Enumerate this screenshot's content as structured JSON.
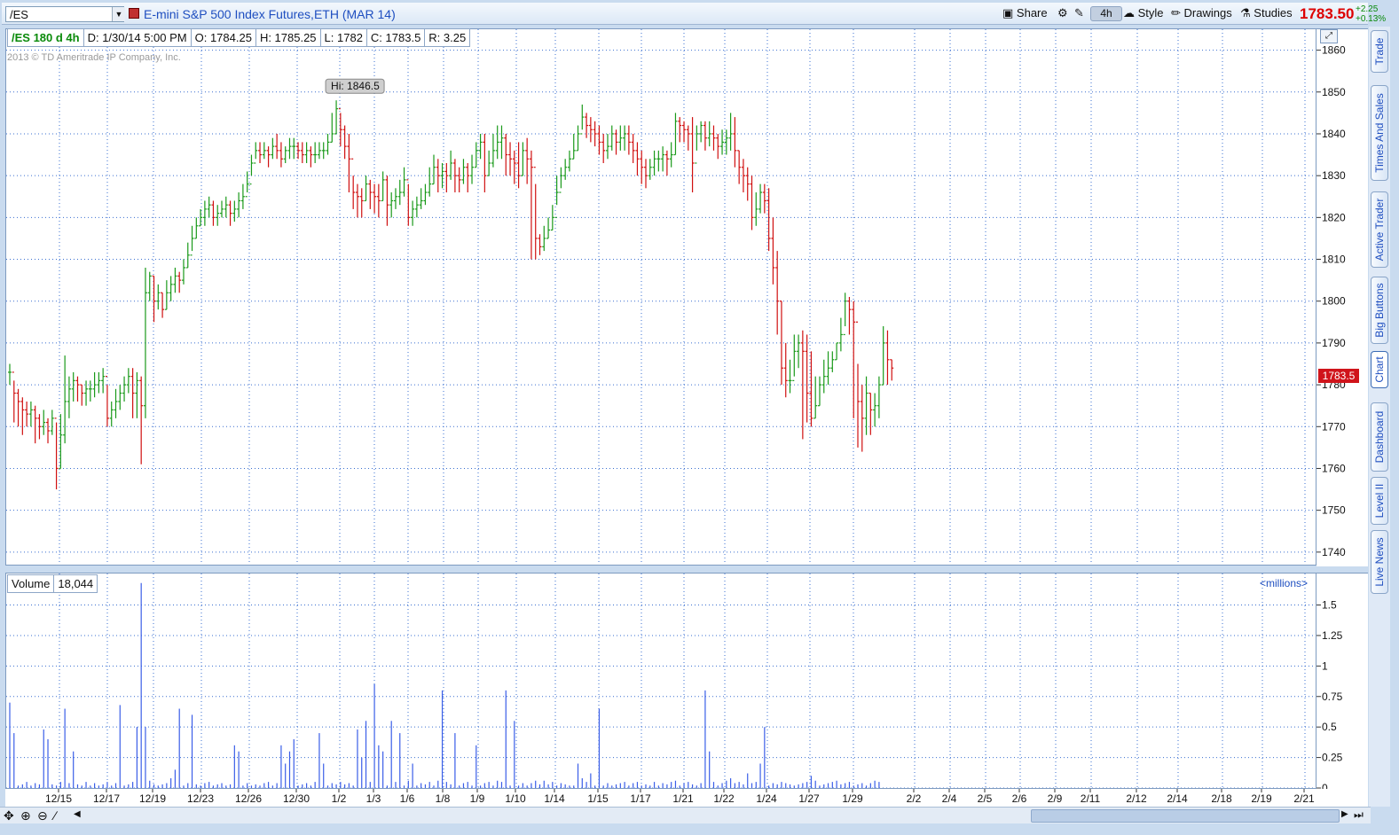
{
  "header": {
    "symbol": "/ES",
    "description": "E-mini S&P 500 Index Futures,ETH (MAR 14)",
    "share_label": "Share",
    "aggregation_label": "4h",
    "style_label": "Style",
    "drawings_label": "Drawings",
    "studies_label": "Studies",
    "last_price": "1783.50",
    "change_abs": "+2.25",
    "change_pct": "+0.13%",
    "colors": {
      "price": "#d00000",
      "change": "#0a8a0a",
      "link": "#1f4fc0"
    }
  },
  "info_bar": {
    "study": "/ES 180 d 4h",
    "date": "D: 1/30/14 5:00 PM",
    "open": "O: 1784.25",
    "high": "H: 1785.25",
    "low": "L: 1782",
    "close": "C: 1783.5",
    "range": "R: 3.25"
  },
  "copyright": "2013 © TD Ameritrade IP Company, Inc.",
  "hi_label": "Hi: 1846.5",
  "last_tag": "1783.5",
  "volume_panel": {
    "label": "Volume",
    "value": "18,044",
    "units": "<millions>"
  },
  "sidebar_tabs": [
    "Trade",
    "Times And Sales",
    "Active Trader",
    "Big Buttons",
    "Chart",
    "Dashboard",
    "Level II",
    "Live News"
  ],
  "chart_data": {
    "type": "bar",
    "subtype": "ohlc",
    "title": "",
    "price_axis": {
      "ticks": [
        1740,
        1750,
        1760,
        1770,
        1780,
        1790,
        1800,
        1810,
        1820,
        1830,
        1840,
        1850,
        1860
      ],
      "ylim": [
        1737,
        1865
      ]
    },
    "volume_axis": {
      "ticks": [
        0,
        0.25,
        0.5,
        0.75,
        1,
        1.25,
        1.5
      ],
      "tick_labels": [
        "0",
        "0.25",
        "0.5",
        "0.75",
        "1",
        "1.25",
        "1.5"
      ],
      "ylim": [
        0,
        1.7
      ],
      "units": "millions"
    },
    "x_labels": [
      "12/15",
      "12/17",
      "12/19",
      "12/23",
      "12/26",
      "12/30",
      "1/2",
      "1/3",
      "1/6",
      "1/8",
      "1/9",
      "1/10",
      "1/14",
      "1/15",
      "1/17",
      "1/21",
      "1/22",
      "1/24",
      "1/27",
      "1/29",
      "2/2",
      "2/4",
      "2/5",
      "2/6",
      "2/9",
      "2/11",
      "2/12",
      "2/14",
      "2/18",
      "2/19",
      "2/21"
    ],
    "grid": true,
    "up_color": "#1a9a1a",
    "down_color": "#d01010",
    "volume_color": "#3a5ee8",
    "close": [
      1783,
      1778,
      1776,
      1774,
      1773,
      1774,
      1772,
      1770,
      1771,
      1769,
      1772,
      1760,
      1768,
      1776,
      1779,
      1781,
      1780,
      1778,
      1779,
      1779,
      1780,
      1781,
      1782,
      1772,
      1774,
      1776,
      1778,
      1780,
      1782,
      1778,
      1781,
      1775,
      1802,
      1806,
      1800,
      1802,
      1798,
      1802,
      1804,
      1806,
      1805,
      1808,
      1811,
      1815,
      1818,
      1820,
      1822,
      1823,
      1820,
      1821,
      1822,
      1823,
      1821,
      1822,
      1824,
      1825,
      1828,
      1833,
      1836,
      1835,
      1836,
      1835,
      1837,
      1836,
      1834,
      1836,
      1837,
      1837,
      1836,
      1835,
      1836,
      1835,
      1835,
      1836,
      1836,
      1838,
      1840,
      1846,
      1841,
      1837,
      1834,
      1826,
      1825,
      1824,
      1828,
      1826,
      1825,
      1824,
      1829,
      1823,
      1824,
      1825,
      1826,
      1829,
      1820,
      1822,
      1823,
      1824,
      1826,
      1828,
      1832,
      1830,
      1831,
      1830,
      1833,
      1830,
      1829,
      1832,
      1830,
      1832,
      1836,
      1838,
      1830,
      1833,
      1836,
      1838,
      1839,
      1835,
      1834,
      1833,
      1830,
      1836,
      1834,
      1832,
      1815,
      1813,
      1815,
      1817,
      1820,
      1826,
      1830,
      1832,
      1834,
      1836,
      1840,
      1844,
      1842,
      1841,
      1840,
      1838,
      1836,
      1837,
      1840,
      1838,
      1839,
      1840,
      1838,
      1836,
      1834,
      1832,
      1830,
      1832,
      1834,
      1834,
      1835,
      1834,
      1835,
      1843,
      1842,
      1841,
      1840,
      1833,
      1840,
      1842,
      1839,
      1840,
      1839,
      1837,
      1838,
      1839,
      1840,
      1836,
      1832,
      1830,
      1828,
      1820,
      1822,
      1826,
      1824,
      1815,
      1808,
      1800,
      1784,
      1781,
      1781,
      1788,
      1790,
      1788,
      1778,
      1772,
      1775,
      1780,
      1782,
      1784,
      1786,
      1790,
      1792,
      1800,
      1798,
      1795,
      1776,
      1772,
      1778,
      1774,
      1775,
      1780,
      1790,
      1786,
      1784
    ],
    "high": [
      1785,
      1781,
      1779,
      1777,
      1776,
      1776,
      1775,
      1773,
      1774,
      1772,
      1774,
      1771,
      1773,
      1787,
      1782,
      1783,
      1782,
      1780,
      1781,
      1781,
      1783,
      1783,
      1784,
      1780,
      1776,
      1779,
      1780,
      1782,
      1784,
      1784,
      1783,
      1782,
      1808,
      1807,
      1806,
      1804,
      1802,
      1805,
      1806,
      1808,
      1807,
      1810,
      1814,
      1818,
      1820,
      1822,
      1824,
      1825,
      1824,
      1823,
      1824,
      1825,
      1824,
      1824,
      1826,
      1828,
      1831,
      1835,
      1838,
      1838,
      1838,
      1837,
      1839,
      1840,
      1838,
      1837,
      1839,
      1839,
      1838,
      1838,
      1838,
      1837,
      1838,
      1838,
      1838,
      1840,
      1845,
      1848,
      1845,
      1842,
      1840,
      1830,
      1828,
      1827,
      1830,
      1829,
      1828,
      1828,
      1831,
      1830,
      1826,
      1827,
      1829,
      1832,
      1828,
      1824,
      1825,
      1827,
      1828,
      1832,
      1835,
      1834,
      1833,
      1833,
      1836,
      1834,
      1832,
      1834,
      1833,
      1835,
      1838,
      1840,
      1840,
      1836,
      1840,
      1842,
      1842,
      1840,
      1838,
      1836,
      1838,
      1838,
      1839,
      1836,
      1828,
      1816,
      1818,
      1820,
      1823,
      1830,
      1832,
      1834,
      1836,
      1840,
      1842,
      1847,
      1845,
      1844,
      1843,
      1842,
      1840,
      1840,
      1842,
      1841,
      1842,
      1842,
      1842,
      1840,
      1838,
      1836,
      1834,
      1834,
      1836,
      1836,
      1837,
      1836,
      1838,
      1845,
      1844,
      1843,
      1842,
      1844,
      1842,
      1843,
      1843,
      1843,
      1842,
      1840,
      1841,
      1841,
      1845,
      1844,
      1836,
      1834,
      1832,
      1830,
      1826,
      1828,
      1828,
      1827,
      1820,
      1812,
      1800,
      1790,
      1786,
      1792,
      1792,
      1793,
      1792,
      1788,
      1782,
      1782,
      1786,
      1788,
      1788,
      1790,
      1796,
      1802,
      1801,
      1800,
      1785,
      1780,
      1782,
      1778,
      1778,
      1782,
      1794,
      1793,
      1786
    ],
    "low": [
      1780,
      1771,
      1770,
      1768,
      1770,
      1770,
      1766,
      1767,
      1768,
      1766,
      1768,
      1755,
      1760,
      1766,
      1772,
      1776,
      1776,
      1775,
      1775,
      1776,
      1777,
      1778,
      1778,
      1770,
      1770,
      1772,
      1774,
      1776,
      1778,
      1772,
      1772,
      1761,
      1772,
      1800,
      1795,
      1798,
      1796,
      1798,
      1800,
      1802,
      1802,
      1804,
      1808,
      1812,
      1815,
      1818,
      1818,
      1820,
      1818,
      1818,
      1820,
      1820,
      1818,
      1819,
      1820,
      1822,
      1826,
      1830,
      1834,
      1833,
      1834,
      1832,
      1834,
      1834,
      1832,
      1833,
      1834,
      1834,
      1834,
      1833,
      1833,
      1832,
      1833,
      1834,
      1834,
      1835,
      1838,
      1840,
      1837,
      1834,
      1826,
      1822,
      1820,
      1820,
      1824,
      1822,
      1821,
      1820,
      1824,
      1818,
      1820,
      1822,
      1823,
      1825,
      1818,
      1818,
      1820,
      1822,
      1823,
      1825,
      1828,
      1826,
      1827,
      1826,
      1829,
      1826,
      1826,
      1828,
      1826,
      1828,
      1832,
      1834,
      1826,
      1830,
      1832,
      1834,
      1834,
      1830,
      1830,
      1828,
      1827,
      1830,
      1828,
      1810,
      1810,
      1811,
      1812,
      1815,
      1817,
      1823,
      1827,
      1829,
      1831,
      1834,
      1836,
      1841,
      1839,
      1838,
      1837,
      1835,
      1833,
      1834,
      1836,
      1835,
      1836,
      1836,
      1835,
      1833,
      1830,
      1828,
      1827,
      1829,
      1830,
      1831,
      1831,
      1830,
      1832,
      1835,
      1838,
      1838,
      1836,
      1826,
      1836,
      1838,
      1836,
      1837,
      1836,
      1834,
      1835,
      1835,
      1836,
      1832,
      1828,
      1826,
      1824,
      1817,
      1818,
      1821,
      1821,
      1812,
      1804,
      1792,
      1780,
      1777,
      1778,
      1782,
      1784,
      1767,
      1771,
      1770,
      1772,
      1775,
      1778,
      1780,
      1783,
      1786,
      1788,
      1794,
      1792,
      1772,
      1765,
      1764,
      1768,
      1768,
      1770,
      1772,
      1780,
      1780,
      1781
    ],
    "volume": [
      0.7,
      0.45,
      0.02,
      0.03,
      0.05,
      0.02,
      0.04,
      0.03,
      0.48,
      0.4,
      0.03,
      0.02,
      0.05,
      0.65,
      0.04,
      0.3,
      0.03,
      0.02,
      0.05,
      0.02,
      0.04,
      0.02,
      0.03,
      0.05,
      0.02,
      0.04,
      0.68,
      0.02,
      0.03,
      0.05,
      0.5,
      1.68,
      0.5,
      0.06,
      0.03,
      0.02,
      0.03,
      0.04,
      0.08,
      0.15,
      0.65,
      0.02,
      0.04,
      0.6,
      0.03,
      0.02,
      0.04,
      0.05,
      0.02,
      0.03,
      0.04,
      0.02,
      0.03,
      0.35,
      0.3,
      0.02,
      0.04,
      0.02,
      0.03,
      0.02,
      0.04,
      0.05,
      0.02,
      0.04,
      0.35,
      0.2,
      0.3,
      0.4,
      0.02,
      0.03,
      0.04,
      0.02,
      0.05,
      0.45,
      0.2,
      0.02,
      0.04,
      0.03,
      0.05,
      0.03,
      0.04,
      0.02,
      0.48,
      0.25,
      0.55,
      0.05,
      0.85,
      0.35,
      0.3,
      0.02,
      0.55,
      0.05,
      0.45,
      0.02,
      0.06,
      0.2,
      0.02,
      0.04,
      0.03,
      0.05,
      0.02,
      0.06,
      0.8,
      0.05,
      0.03,
      0.45,
      0.02,
      0.04,
      0.05,
      0.02,
      0.35,
      0.02,
      0.04,
      0.05,
      0.02,
      0.06,
      0.05,
      0.8,
      0.02,
      0.55,
      0.02,
      0.04,
      0.02,
      0.04,
      0.06,
      0.03,
      0.06,
      0.03,
      0.05,
      0.02,
      0.04,
      0.03,
      0.02,
      0.02,
      0.2,
      0.08,
      0.05,
      0.12,
      0.02,
      0.65,
      0.02,
      0.04,
      0.02,
      0.03,
      0.04,
      0.05,
      0.02,
      0.04,
      0.05,
      0.02,
      0.03,
      0.02,
      0.05,
      0.02,
      0.04,
      0.03,
      0.05,
      0.06,
      0.02,
      0.04,
      0.05,
      0.03,
      0.02,
      0.04,
      0.8,
      0.3,
      0.05,
      0.02,
      0.04,
      0.06,
      0.08,
      0.04,
      0.05,
      0.03,
      0.12,
      0.04,
      0.05,
      0.2,
      0.5,
      0.02,
      0.04,
      0.03,
      0.05,
      0.04,
      0.03,
      0.02,
      0.03,
      0.04,
      0.05,
      0.1,
      0.06,
      0.02,
      0.03,
      0.04,
      0.05,
      0.06,
      0.03,
      0.04,
      0.05,
      0.02,
      0.03,
      0.04,
      0.02,
      0.04,
      0.06,
      0.05,
      0.04,
      0.03,
      0.04,
      0.05,
      0.03,
      0.02,
      0.04,
      0.05,
      0.06,
      0.03,
      0.04,
      0.05,
      0.02,
      0.03,
      0.04,
      0.05,
      0.03,
      0.02,
      0.04,
      0.05
    ]
  }
}
